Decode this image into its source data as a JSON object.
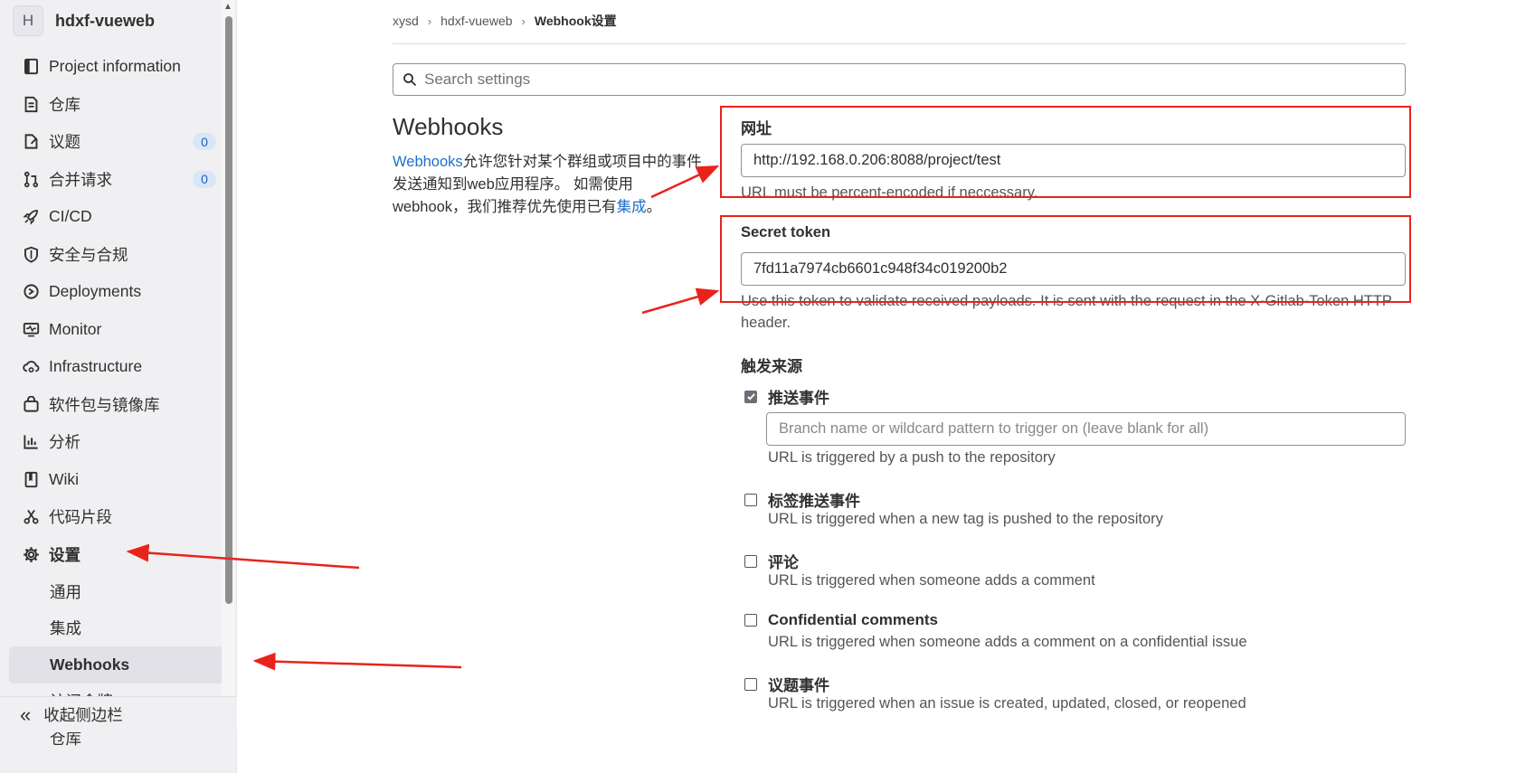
{
  "sidebar": {
    "avatar_letter": "H",
    "project_name": "hdxf-vueweb",
    "items": [
      {
        "label": "Project information",
        "icon": "project-info-icon"
      },
      {
        "label": "仓库",
        "icon": "repository-icon"
      },
      {
        "label": "议题",
        "icon": "issues-icon",
        "badge": "0"
      },
      {
        "label": "合并请求",
        "icon": "merge-request-icon",
        "badge": "0"
      },
      {
        "label": "CI/CD",
        "icon": "rocket-icon"
      },
      {
        "label": "安全与合规",
        "icon": "shield-icon"
      },
      {
        "label": "Deployments",
        "icon": "deployments-icon"
      },
      {
        "label": "Monitor",
        "icon": "monitor-icon"
      },
      {
        "label": "Infrastructure",
        "icon": "cloud-gear-icon"
      },
      {
        "label": "软件包与镜像库",
        "icon": "package-icon"
      },
      {
        "label": "分析",
        "icon": "chart-icon"
      },
      {
        "label": "Wiki",
        "icon": "book-icon"
      },
      {
        "label": "代码片段",
        "icon": "scissors-icon"
      },
      {
        "label": "设置",
        "icon": "gear-icon"
      }
    ],
    "sub_items": [
      "通用",
      "集成",
      "Webhooks",
      "访问令牌",
      "仓库"
    ],
    "collapse_label": "收起侧边栏"
  },
  "breadcrumb": {
    "group": "xysd",
    "project": "hdxf-vueweb",
    "current": "Webhook设置"
  },
  "search": {
    "placeholder": "Search settings"
  },
  "webhooks": {
    "title": "Webhooks",
    "desc_link": "Webhooks",
    "desc_text": "允许您针对某个群组或项目中的事件发送通知到web应用程序。 如需使用webhook，我们推荐优先使用已有",
    "desc_link2": "集成",
    "desc_end": "。"
  },
  "form": {
    "url_label": "网址",
    "url_value": "http://192.168.0.206:8088/project/test",
    "url_help": "URL must be percent-encoded if neccessary.",
    "token_label": "Secret token",
    "token_value": "7fd11a7974cb6601c948f34c019200b2",
    "token_help": "Use this token to validate received payloads. It is sent with the request in the X-Gitlab-Token HTTP header.",
    "trigger_label": "触发来源",
    "branch_placeholder": "Branch name or wildcard pattern to trigger on (leave blank for all)",
    "triggers": [
      {
        "label": "推送事件",
        "checked": true,
        "help": "URL is triggered by a push to the repository"
      },
      {
        "label": "标签推送事件",
        "checked": false,
        "help": "URL is triggered when a new tag is pushed to the repository"
      },
      {
        "label": "评论",
        "checked": false,
        "help": "URL is triggered when someone adds a comment"
      },
      {
        "label": "Confidential comments",
        "checked": false,
        "help": "URL is triggered when someone adds a comment on a confidential issue"
      },
      {
        "label": "议题事件",
        "checked": false,
        "help": "URL is triggered when an issue is created, updated, closed, or reopened"
      }
    ]
  },
  "colors": {
    "accent": "#1f6fc5",
    "annotation": "#e8231b"
  }
}
